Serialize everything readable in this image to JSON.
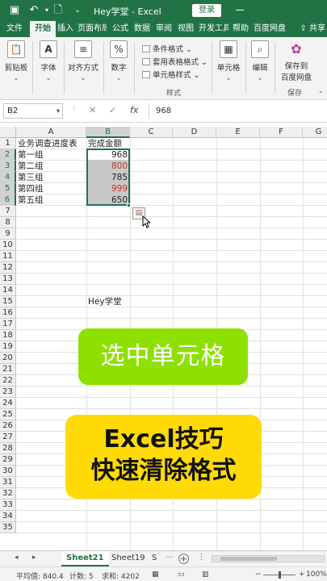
{
  "titlebar": {
    "title": "Hey学堂  -  Excel",
    "login_label": "登录"
  },
  "tabs": [
    "文件",
    "开始",
    "插入",
    "页面布局",
    "公式",
    "数据",
    "审阅",
    "视图",
    "开发工具",
    "帮助",
    "百度网盘"
  ],
  "share_label": "共享",
  "ribbon": {
    "clipboard": "剪贴板",
    "font": "字体",
    "alignment": "对齐方式",
    "number": "数字",
    "number_symbol": "%",
    "styles": {
      "conditional": "条件格式",
      "table": "套用表格格式",
      "cell": "单元格样式",
      "group": "样式"
    },
    "cells": "单元格",
    "edit": "编辑",
    "save_line1": "保存到",
    "save_line2": "百度网盘",
    "save_group": "保存"
  },
  "formula_bar": {
    "name_box": "B2",
    "value": "968"
  },
  "columns": [
    "A",
    "B",
    "C",
    "D",
    "E",
    "F",
    "G"
  ],
  "rows": [
    "1",
    "2",
    "3",
    "4",
    "5",
    "6",
    "7",
    "8",
    "9",
    "10",
    "11",
    "12",
    "13",
    "14",
    "15",
    "16",
    "17",
    "18",
    "19",
    "20",
    "21",
    "22",
    "23",
    "24",
    "25",
    "26",
    "27",
    "28",
    "29",
    "30",
    "31",
    "32",
    "33",
    "34",
    "35"
  ],
  "cells": {
    "A1": "业务调查进度表",
    "B1": "完成金额",
    "A2": "第一组",
    "A3": "第二组",
    "A4": "第三组",
    "A5": "第四组",
    "A6": "第五组",
    "B2": "968",
    "B3": "800",
    "B4": "785",
    "B5": "999",
    "B6": "650",
    "B15": "Hey学堂"
  },
  "number_colors": {
    "B2": "#222222",
    "B3": "#c0392b",
    "B4": "#222222",
    "B5": "#c0392b",
    "B6": "#222222"
  },
  "overlay": {
    "green_text": "选中单元格",
    "yellow_line1": "Excel技巧",
    "yellow_line2": "快速清除格式"
  },
  "sheets": [
    "Sheet21",
    "Sheet19",
    "S"
  ],
  "status": {
    "average": "平均值: 840.4",
    "count": "计数: 5",
    "sum": "求和: 4202",
    "zoom": "100%"
  },
  "colors": {
    "excel_green": "#217346",
    "banner_green": "#8ee000",
    "banner_yellow": "#ffda06"
  }
}
